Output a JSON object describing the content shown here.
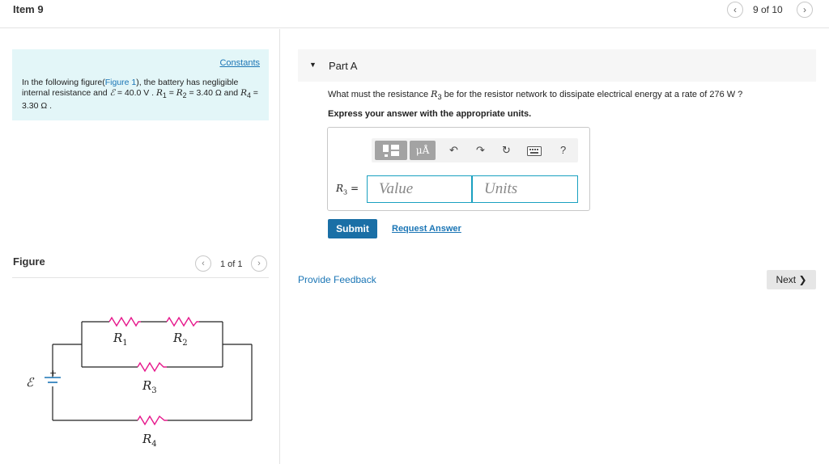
{
  "header": {
    "item_title": "Item 9",
    "pager_text": "9 of 10",
    "prev_glyph": "‹",
    "next_glyph": "›"
  },
  "problem": {
    "constants_label": "Constants",
    "text_pre": "In the following figure(",
    "figure_link": "Figure 1",
    "text_mid": "), the battery has negligible internal resistance and ",
    "emf_symbol": "ℰ",
    "emf_value": " = 40.0 V . ",
    "r1_sym": "R",
    "r1_sub": "1",
    "eq_mid": " = ",
    "r2_sym": "R",
    "r2_sub": "2",
    "r12_value": " = 3.40 Ω and ",
    "r4_sym": "R",
    "r4_sub": "4",
    "r4_value": " = 3.30 Ω ."
  },
  "figure": {
    "title": "Figure",
    "pager_text": "1 of 1",
    "emf_label": "ℰ",
    "plus_label": "+",
    "r1_label": "R",
    "r1_sub": "1",
    "r2_label": "R",
    "r2_sub": "2",
    "r3_label": "R",
    "r3_sub": "3",
    "r4_label": "R",
    "r4_sub": "4"
  },
  "part": {
    "label": "Part A",
    "caret": "▼",
    "question_pre": "What must the resistance ",
    "q_r_sym": "R",
    "q_r_sub": "3",
    "question_post": " be for the resistor network to dissipate electrical energy at a rate of 276 W ?",
    "instruction": "Express your answer with the appropriate units."
  },
  "answer": {
    "mu_label": "μÅ",
    "undo_glyph": "↶",
    "redo_glyph": "↷",
    "reset_glyph": "↻",
    "help_glyph": "?",
    "var_sym": "R",
    "var_sub": "3",
    "var_eq": " =",
    "value_placeholder": "Value",
    "units_placeholder": "Units"
  },
  "actions": {
    "submit_label": "Submit",
    "request_answer_label": "Request Answer",
    "feedback_label": "Provide Feedback",
    "next_label": "Next ❯"
  },
  "colors": {
    "accent": "#1a75b5",
    "submit_bg": "#1a6fa6",
    "info_bg": "#e3f6f8",
    "resistor": "#e6188c",
    "input_border": "#1aa0c0"
  }
}
